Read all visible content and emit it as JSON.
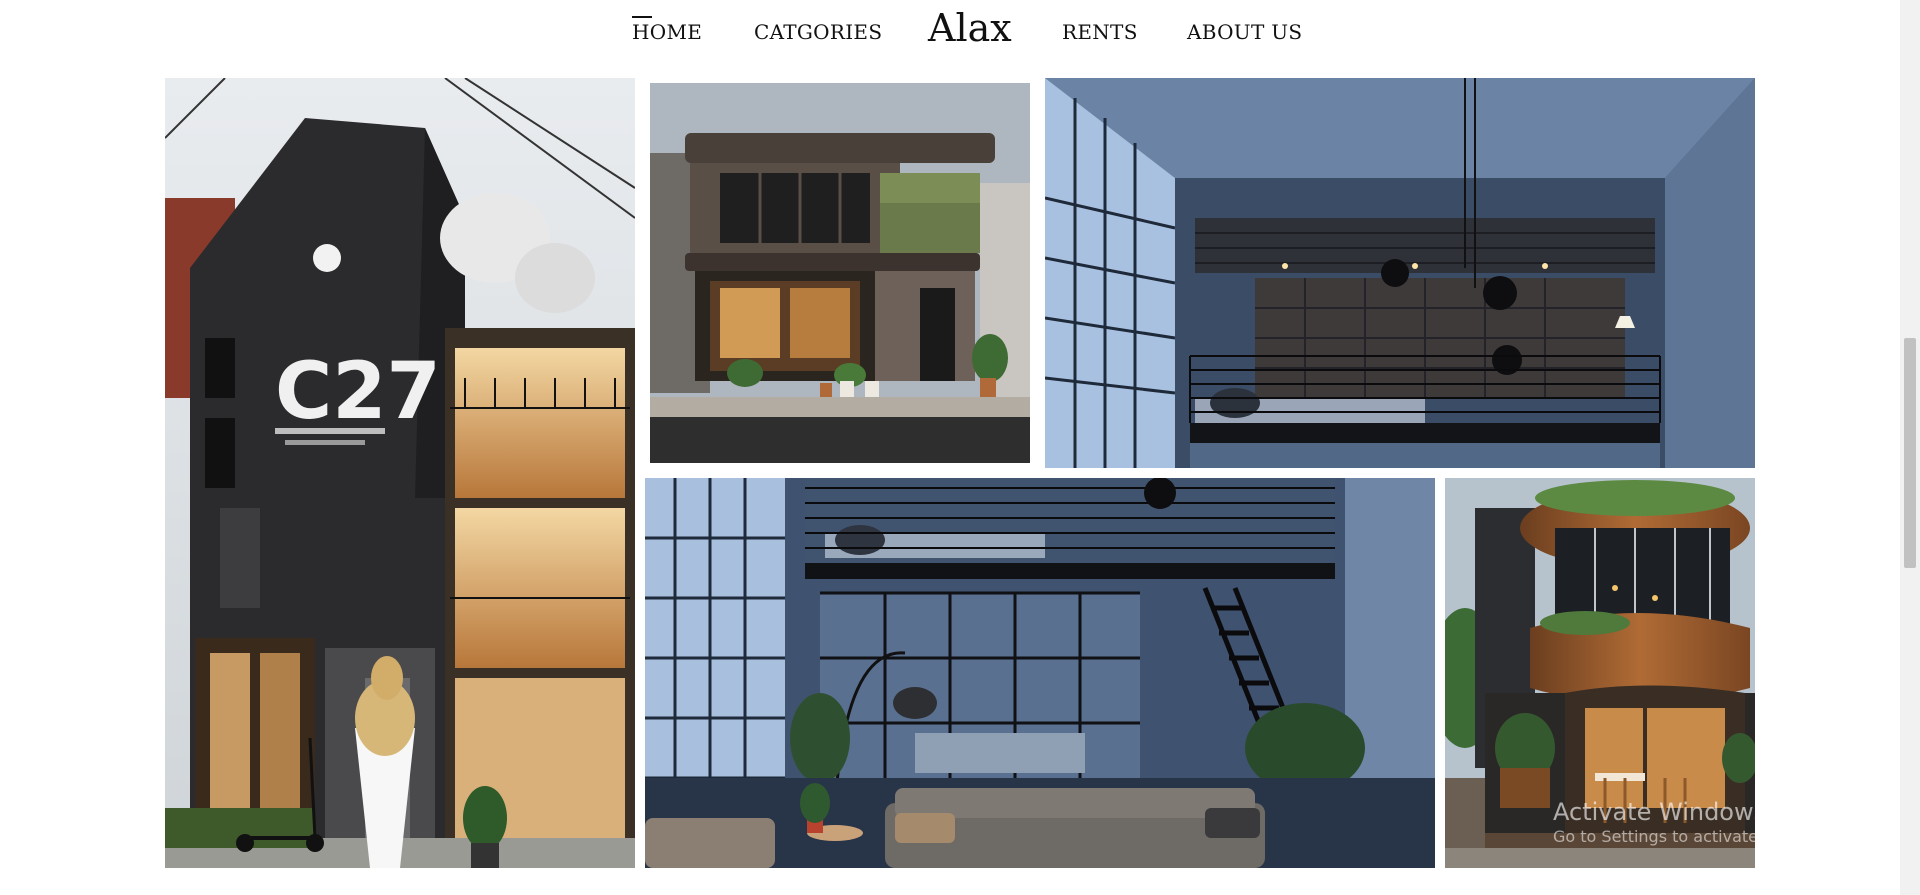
{
  "nav": {
    "left_items": [
      {
        "label": "HOME",
        "active": true
      },
      {
        "label": "CATGORIES"
      }
    ],
    "brand": "Alax",
    "right_items": [
      {
        "label": "RENTS"
      },
      {
        "label": "ABOUT US"
      }
    ]
  },
  "gallery": {
    "tiles": [
      {
        "subject": "brick cafe building with ice-cream cone statue",
        "sign_text": "C27"
      },
      {
        "subject": "concrete two-story cafe facade with plants"
      },
      {
        "subject": "industrial loft mezzanine bedroom"
      },
      {
        "subject": "loft living room with staircase and kitchen"
      },
      {
        "subject": "curved wooden cafe building"
      }
    ]
  },
  "watermark": {
    "title": "Activate Windows",
    "subtitle": "Go to Settings to activate Windows."
  },
  "colors": {
    "nav_text": "#111111",
    "background": "#ffffff",
    "scroll_thumb": "#c1c1c1"
  }
}
